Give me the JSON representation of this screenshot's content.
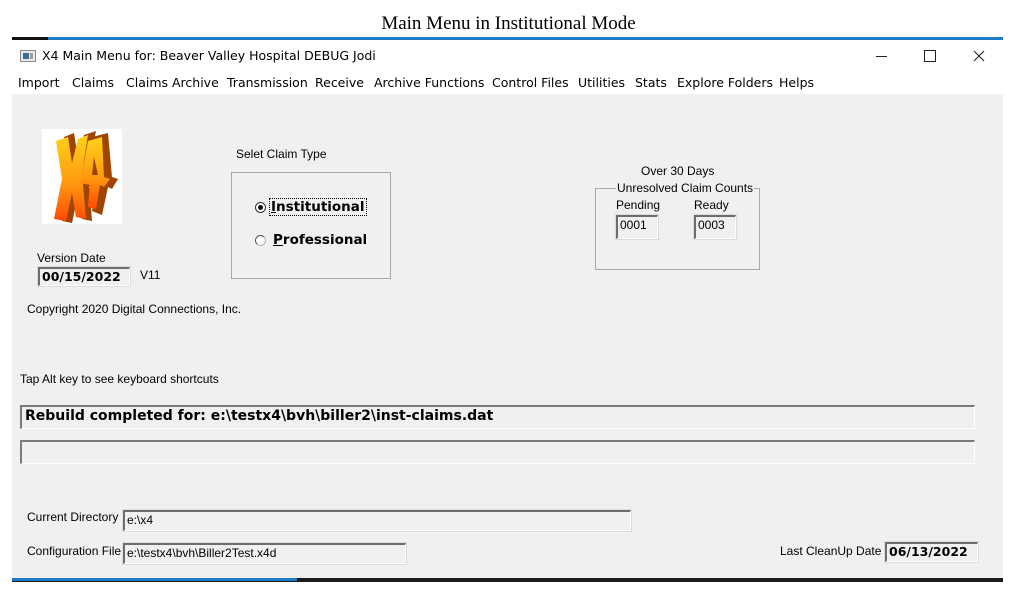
{
  "caption": "Main Menu in Institutional Mode",
  "window": {
    "title": "X4 Main Menu for: Beaver Valley Hospital DEBUG  Jodi",
    "app_icon": "app-window-icon",
    "controls": {
      "minimize": "—",
      "maximize": "☐",
      "close": "✕"
    }
  },
  "menu": {
    "items": [
      {
        "label": "Import"
      },
      {
        "label": "Claims"
      },
      {
        "label": "Claims Archive"
      },
      {
        "label": "Transmission"
      },
      {
        "label": "Receive"
      },
      {
        "label": "Archive Functions"
      },
      {
        "label": "Control Files"
      },
      {
        "label": "Utilities"
      },
      {
        "label": "Stats"
      },
      {
        "label": "Explore Folders"
      },
      {
        "label": "Helps"
      }
    ]
  },
  "logo": {
    "text": "X4",
    "icon": "x4-logo-icon"
  },
  "version": {
    "label": "Version Date",
    "date": "00/15/2022",
    "version": "V11"
  },
  "copyright": "Copyright 2020 Digital Connections, Inc.",
  "claim_type": {
    "label": "Selet Claim Type",
    "options": [
      {
        "label_first": "I",
        "label_rest": "nstitutional",
        "checked": true
      },
      {
        "label_first": "P",
        "label_rest": "rofessional",
        "checked": false
      }
    ]
  },
  "unresolved": {
    "heading": "Over 30 Days",
    "group_label": "Unresolved Claim Counts",
    "pending_label": "Pending",
    "pending_value": "0001",
    "ready_label": "Ready",
    "ready_value": "0003"
  },
  "hint": "Tap Alt key to see keyboard shortcuts",
  "status": {
    "line1": "Rebuild completed for: e:\\testx4\\bvh\\biller2\\inst-claims.dat",
    "line2": ""
  },
  "footer": {
    "current_directory_label": "Current Directory",
    "current_directory": "e:\\x4",
    "config_file_label": "Configuration File",
    "config_file": "e:\\testx4\\bvh\\Biller2Test.x4d",
    "last_cleanup_label": "Last CleanUp Date",
    "last_cleanup": "06/13/2022"
  }
}
